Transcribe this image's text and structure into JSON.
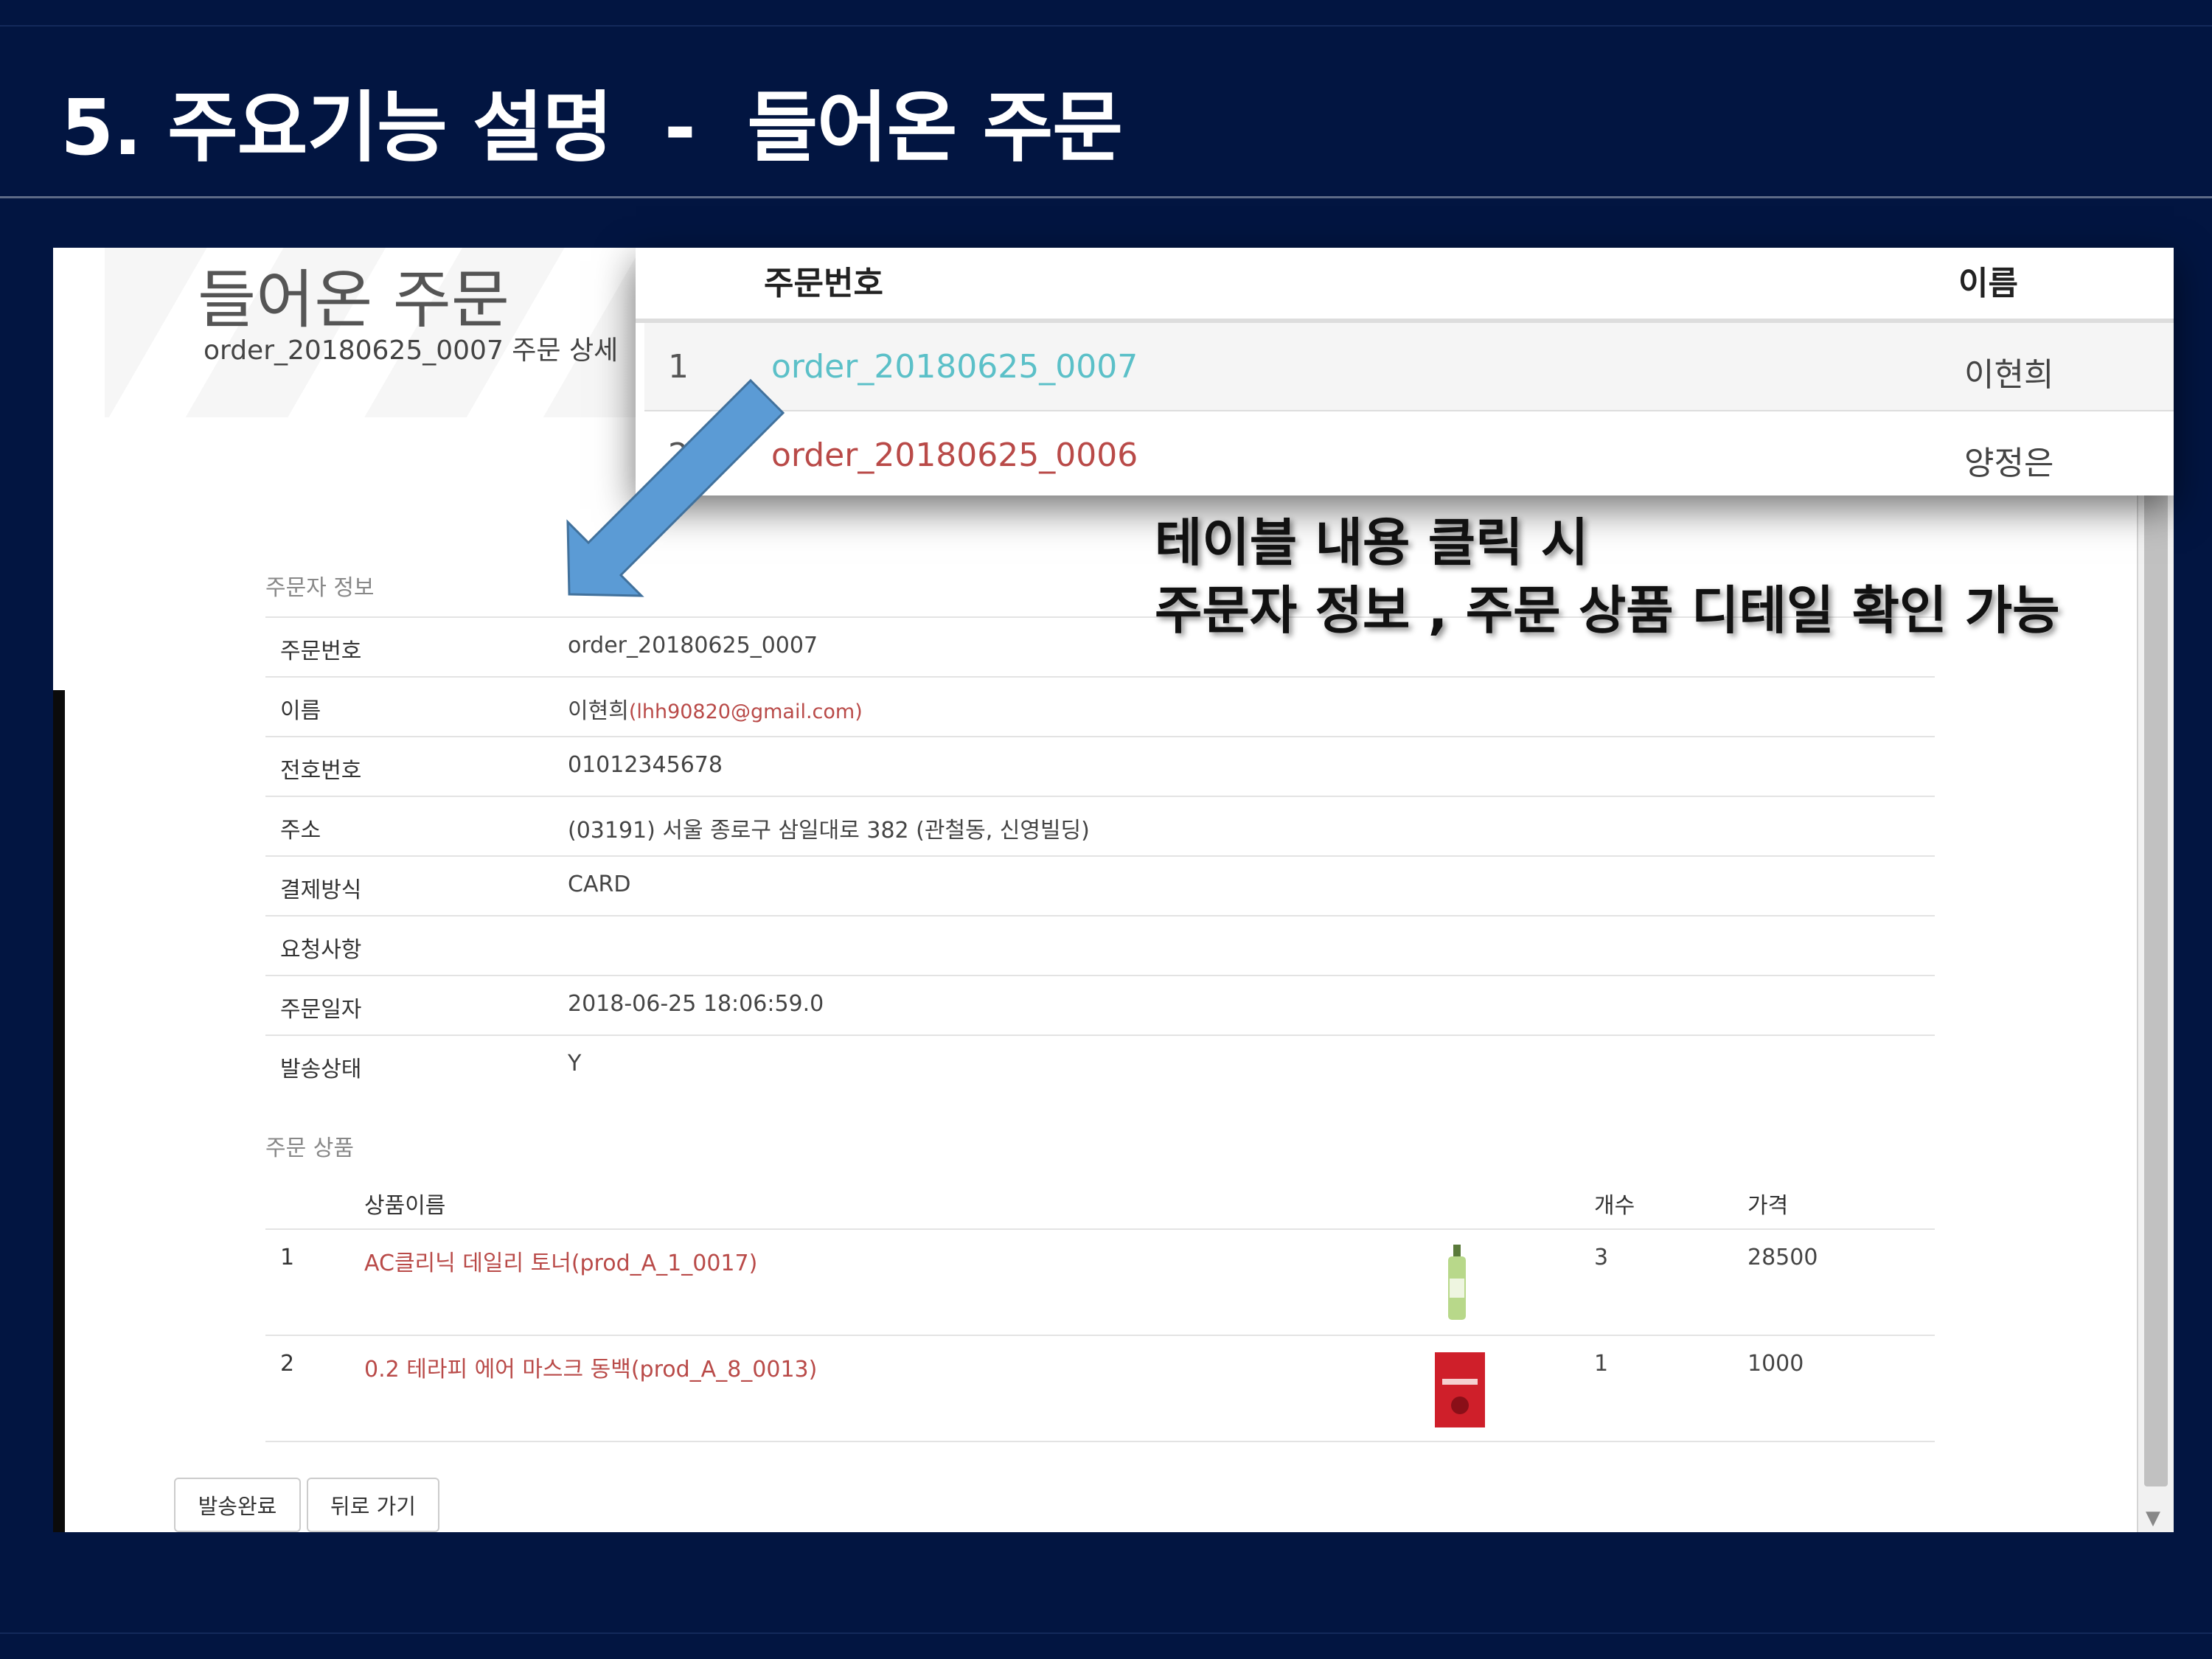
{
  "slide": {
    "title": "5. 주요기능 설명  -  들어온 주문",
    "annotation": {
      "line1": "테이블 내용 클릭 시",
      "line2": "주문자 정보 , 주문 상품 디테일 확인 가능"
    },
    "colors": {
      "background": "#021541",
      "arrow": "#5b9bd5",
      "link_selected": "#5bc0c8",
      "link": "#b94a48"
    }
  },
  "order_list_popup": {
    "headers": {
      "order_no": "주문번호",
      "name": "이름"
    },
    "rows": [
      {
        "num": "1",
        "order": "order_20180625_0007",
        "name": "이현희",
        "selected": true
      },
      {
        "num": "2",
        "order": "order_20180625_0006",
        "name": "양정은",
        "selected": false
      }
    ]
  },
  "detail_page": {
    "heading": "들어온 주문",
    "subheading": "order_20180625_0007 주문 상세",
    "orderer_section": "주문자 정보",
    "orderer_info": [
      {
        "label": "주문번호",
        "value": "order_20180625_0007"
      },
      {
        "label": "이름",
        "value": "이현희",
        "email": "(lhh90820@gmail.com)"
      },
      {
        "label": "전호번호",
        "value": "01012345678"
      },
      {
        "label": "주소",
        "value": "(03191) 서울 종로구 삼일대로 382 (관철동, 신영빌딩)"
      },
      {
        "label": "결제방식",
        "value": "CARD"
      },
      {
        "label": "요청사항",
        "value": ""
      },
      {
        "label": "주문일자",
        "value": "2018-06-25 18:06:59.0"
      },
      {
        "label": "발송상태",
        "value": "Y"
      }
    ],
    "products_section": "주문 상품",
    "product_headers": {
      "name": "상품이름",
      "qty": "개수",
      "price": "가격"
    },
    "products": [
      {
        "num": "1",
        "name": "AC클리닉 데일리 토너(prod_A_1_0017)",
        "qty": "3",
        "price": "28500",
        "image_icon": "toner-bottle-icon"
      },
      {
        "num": "2",
        "name": "0.2 테라피 에어 마스크 동백(prod_A_8_0013)",
        "qty": "1",
        "price": "1000",
        "image_icon": "mask-pack-icon"
      }
    ],
    "buttons": {
      "complete": "발송완료",
      "back": "뒤로 가기"
    }
  }
}
